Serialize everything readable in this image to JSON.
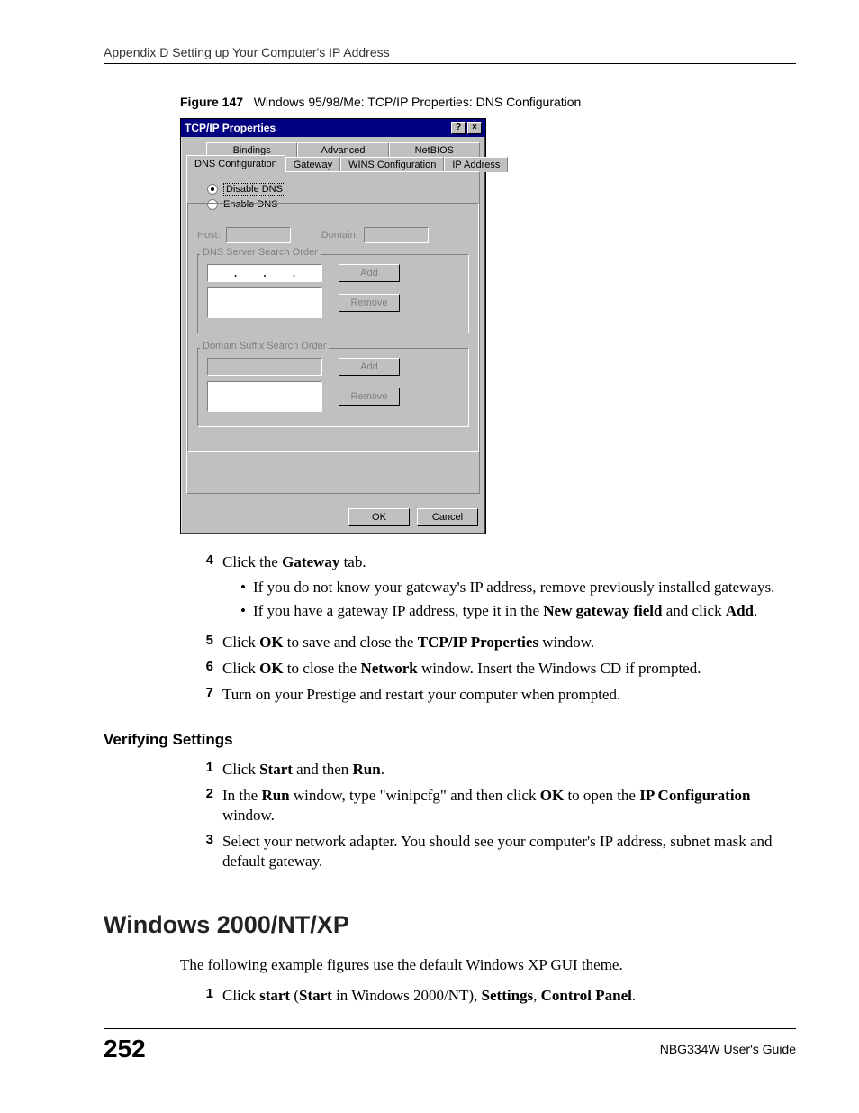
{
  "header": "Appendix D Setting up Your Computer's IP Address",
  "figure": {
    "label": "Figure 147",
    "caption": "Windows 95/98/Me: TCP/IP Properties: DNS Configuration"
  },
  "dialog": {
    "title": "TCP/IP Properties",
    "help_btn": "?",
    "close_btn": "×",
    "tabs_row1": {
      "bindings": "Bindings",
      "advanced": "Advanced",
      "netbios": "NetBIOS"
    },
    "tabs_row2": {
      "dns": "DNS Configuration",
      "gateway": "Gateway",
      "wins": "WINS Configuration",
      "ip": "IP Address"
    },
    "radio_disable": "Disable DNS",
    "radio_enable": "Enable DNS",
    "host_label": "Host:",
    "domain_label": "Domain:",
    "dns_search": "DNS Server Search Order",
    "domain_suffix": "Domain Suffix Search Order",
    "add": "Add",
    "remove": "Remove",
    "ok": "OK",
    "cancel": "Cancel"
  },
  "steps1": {
    "4": {
      "pre": "Click the ",
      "bold": "Gateway",
      "post": " tab."
    },
    "bullets": [
      "If you do not know your gateway's IP address, remove previously installed gateways.",
      {
        "t1": "If you have a gateway IP address, type it in the ",
        "b1": "New gateway field",
        "t2": " and click ",
        "b2": "Add",
        "t3": "."
      }
    ],
    "5": {
      "t1": "Click ",
      "b1": "OK",
      "t2": " to save and close the ",
      "b2": "TCP/IP Properties",
      "t3": " window."
    },
    "6": {
      "t1": "Click ",
      "b1": "OK",
      "t2": " to close the ",
      "b2": "Network",
      "t3": " window. Insert the Windows CD if prompted."
    },
    "7": "Turn on your Prestige and restart your computer when prompted."
  },
  "subhead": "Verifying Settings",
  "steps2": {
    "1": {
      "t1": "Click ",
      "b1": "Start",
      "t2": " and then ",
      "b2": "Run",
      "t3": "."
    },
    "2": {
      "t1": "In the ",
      "b1": "Run",
      "t2": " window, type \"winipcfg\" and then click ",
      "b2": "OK",
      "t3": " to open the ",
      "b3": "IP Configuration",
      "t4": " window."
    },
    "3": "Select your network adapter. You should see your computer's IP address, subnet mask and default gateway."
  },
  "heading2": "Windows 2000/NT/XP",
  "para_xp": "The following example figures use the default Windows XP GUI theme.",
  "step_xp": {
    "t1": "Click ",
    "b1": "start",
    "t2": " (",
    "b2": "Start",
    "t3": " in Windows 2000/NT), ",
    "b3": "Settings",
    "t4": ", ",
    "b4": "Control Panel",
    "t5": "."
  },
  "page_num": "252",
  "guide": "NBG334W User's Guide"
}
